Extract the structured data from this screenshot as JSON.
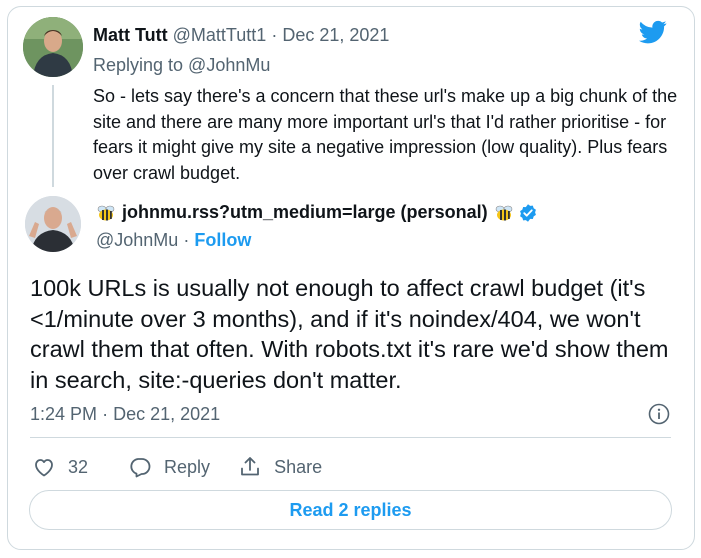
{
  "colors": {
    "accent": "#1d9bf0",
    "text": "#0f1419",
    "muted": "#536471",
    "border": "#cfd9de"
  },
  "embed": {
    "logo_icon": "twitter-bird-icon"
  },
  "reply": {
    "author_name": "Matt Tutt",
    "author_handle": "@MattTutt1",
    "date": "Dec 21, 2021",
    "replying_to": "Replying to @JohnMu",
    "text": "So - lets say there's a concern that these url's make up a big chunk of the site and there are many more important url's that I'd rather prioritise - for fears it might give my site a negative impression (low quality). Plus fears over crawl budget."
  },
  "tweet": {
    "author_name": "johnmu.rss?utm_medium=large (personal)",
    "name_emoji": "bee-emoji-icon",
    "verified_icon": "verified-badge-icon",
    "author_handle": "@JohnMu",
    "follow_label": "Follow",
    "text": "100k URLs is usually not enough to affect crawl budget (it's <1/minute over 3 months), and if it's noindex/404, we won't crawl them that often. With robots.txt it's rare we'd show them in search, site:-queries don't matter.",
    "time": "1:24 PM",
    "date": "Dec 21, 2021",
    "likes": "32",
    "reply_label": "Reply",
    "share_label": "Share",
    "read_replies_label": "Read 2 replies"
  }
}
